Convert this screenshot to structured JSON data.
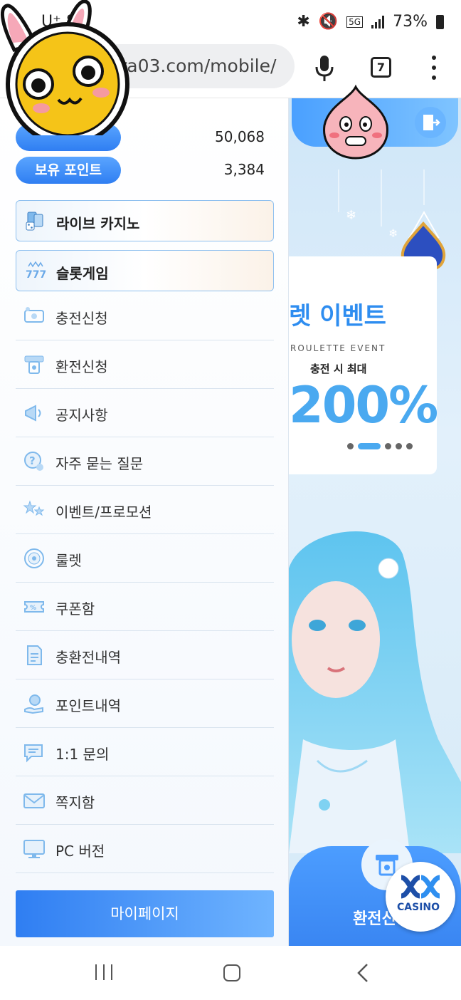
{
  "status_bar": {
    "time": "U⁺ 8:3",
    "battery": "73%",
    "network": "5G"
  },
  "browser": {
    "url": "ra03.com/mobile/",
    "tab_count": "7"
  },
  "sidebar": {
    "stats": [
      {
        "label": "",
        "value": "50,068"
      },
      {
        "label": "보유 포인트",
        "value": "3,384"
      }
    ],
    "featured": [
      {
        "label": "라이브 카지노",
        "icon": "cards-dice-icon"
      },
      {
        "label": "슬롯게임",
        "icon": "slot-777-icon"
      }
    ],
    "items": [
      {
        "label": "충전신청",
        "icon": "deposit-icon"
      },
      {
        "label": "환전신청",
        "icon": "withdraw-icon"
      },
      {
        "label": "공지사항",
        "icon": "megaphone-icon"
      },
      {
        "label": "자주 묻는 질문",
        "icon": "faq-icon"
      },
      {
        "label": "이벤트/프로모션",
        "icon": "stars-icon"
      },
      {
        "label": "룰렛",
        "icon": "roulette-icon"
      },
      {
        "label": "쿠폰함",
        "icon": "coupon-icon"
      },
      {
        "label": "충환전내역",
        "icon": "document-icon"
      },
      {
        "label": "포인트내역",
        "icon": "points-hand-icon"
      },
      {
        "label": "1:1 문의",
        "icon": "chat-icon"
      },
      {
        "label": "쪽지함",
        "icon": "envelope-icon"
      },
      {
        "label": "PC 버전",
        "icon": "monitor-icon"
      }
    ],
    "mypage_label": "마이페이지"
  },
  "banner": {
    "title": "렛 이벤트",
    "subtitle": "ROULETTE EVENT",
    "max_label": "충전 시 최대",
    "percent": "200%",
    "active_slide": 2,
    "slide_count": 5
  },
  "bottom": {
    "label": "환전신",
    "casino_badge": "CASINO"
  },
  "colors": {
    "accent": "#2f7ef2",
    "accent_light": "#6fb4ff",
    "border": "#8fc0ef"
  }
}
